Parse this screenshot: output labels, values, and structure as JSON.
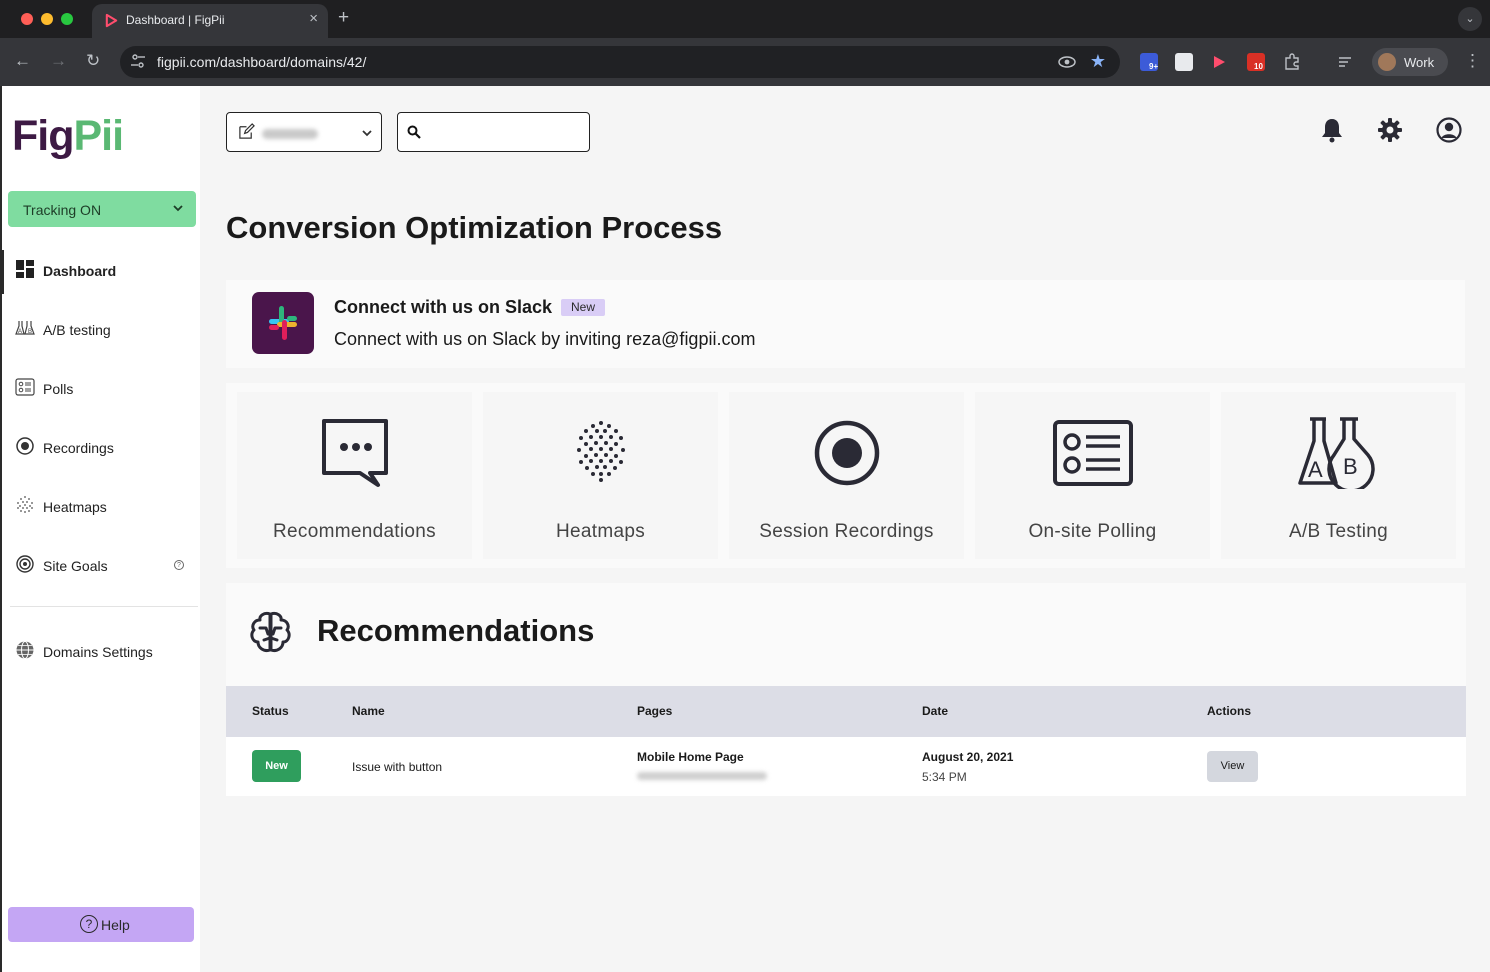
{
  "browser": {
    "tab_title": "Dashboard | FigPii",
    "url": "figpii.com/dashboard/domains/42/",
    "profile_name": "Work",
    "extension_badges": [
      "9+",
      "10"
    ]
  },
  "sidebar": {
    "logo": {
      "part1": "Fig",
      "part2": "Pii"
    },
    "tracking_label": "Tracking ON",
    "items": [
      {
        "label": "Dashboard",
        "icon": "dashboard-grid-icon",
        "active": true
      },
      {
        "label": "A/B testing",
        "icon": "ab-testing-icon"
      },
      {
        "label": "Polls",
        "icon": "polls-icon"
      },
      {
        "label": "Recordings",
        "icon": "recording-icon"
      },
      {
        "label": "Heatmaps",
        "icon": "heatmap-icon"
      },
      {
        "label": "Site Goals",
        "icon": "target-icon"
      },
      {
        "label": "Domains Settings",
        "icon": "globe-icon"
      }
    ],
    "help_label": "Help"
  },
  "header": {
    "search_placeholder": "",
    "icons": [
      "bell-icon",
      "gear-icon",
      "user-circle-icon"
    ]
  },
  "main": {
    "title": "Conversion Optimization Process",
    "slack": {
      "title": "Connect with us on Slack",
      "badge": "New",
      "description": "Connect with us on Slack by inviting reza@figpii.com"
    },
    "features": [
      {
        "label": "Recommendations",
        "icon": "chat-bubble-icon"
      },
      {
        "label": "Heatmaps",
        "icon": "heatmap-dots-icon"
      },
      {
        "label": "Session Recordings",
        "icon": "record-icon"
      },
      {
        "label": "On-site Polling",
        "icon": "poll-form-icon"
      },
      {
        "label": "A/B Testing",
        "icon": "flasks-icon"
      }
    ],
    "recommendations": {
      "title": "Recommendations",
      "columns": [
        "Status",
        "Name",
        "Pages",
        "Date",
        "Actions"
      ],
      "rows": [
        {
          "status": "New",
          "name": "Issue with button",
          "page": "Mobile Home Page",
          "date": "August 20, 2021",
          "time": "5:34 PM",
          "action": "View"
        }
      ]
    }
  },
  "colors": {
    "brand_dark": "#3d1a44",
    "brand_green": "#5ab873",
    "tracking_bg": "#7fdca0",
    "help_bg": "#c4a6f4",
    "status_new": "#2f9e5d",
    "slack_bg": "#4a154b"
  }
}
